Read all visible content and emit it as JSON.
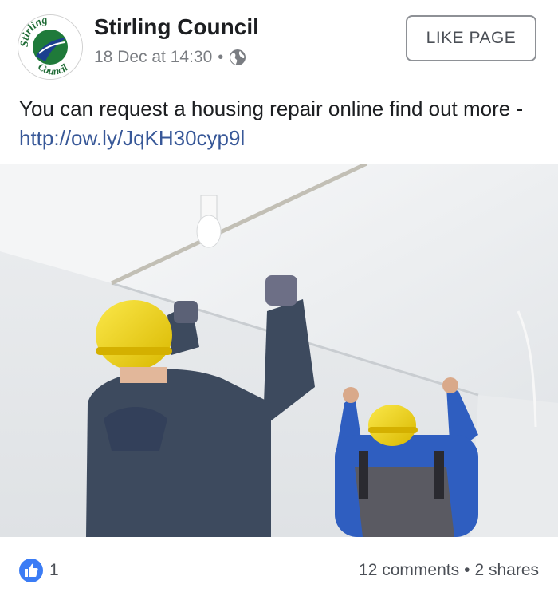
{
  "post": {
    "page_name": "Stirling Council",
    "timestamp": "18 Dec at 14:30",
    "meta_separator": "•",
    "privacy_icon": "globe-icon",
    "like_page_label": "LIKE PAGE",
    "text_prefix": "You can request a housing repair online find out more - ",
    "link_text": "http://ow.ly/JqKH30cyp9l"
  },
  "avatar": {
    "logo_top_text": "Stirling",
    "logo_bottom_text": "Council",
    "colors": {
      "green": "#1f7a3a",
      "blue": "#1b3f8f",
      "text": "#1f6b35"
    }
  },
  "image": {
    "description_icon": "photo-workers-installing-ceiling",
    "colors": {
      "hat": "#f2d200",
      "hoodie": "#3d4a5e",
      "blue_shirt": "#2f5ec0",
      "overalls": "#5a5a62",
      "ceiling": "#f2f4f5",
      "wall": "#e6e9ec"
    }
  },
  "footer": {
    "like_icon": "thumbs-up-icon",
    "like_count": "1",
    "comments": "12 comments",
    "separator": "•",
    "shares": "2 shares"
  },
  "colors": {
    "link": "#385898",
    "like_blue": "#3b7cf5",
    "meta_gray": "#7a7d82"
  }
}
